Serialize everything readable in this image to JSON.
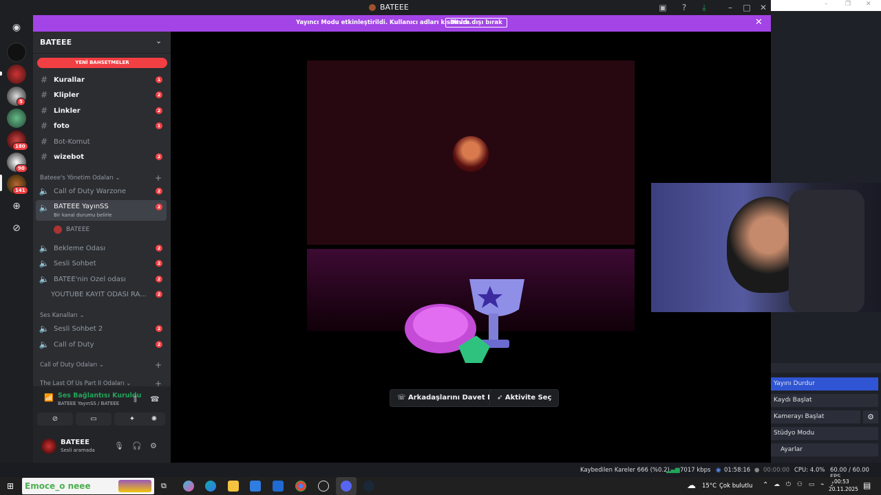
{
  "window": {
    "title": "BATEEE"
  },
  "banner": {
    "message": "Yayıncı Modu etkinleştirildi. Kullanıcı adları kısaltıldı.",
    "button": "Devre dışı bırak"
  },
  "servers": {
    "badges": [
      "5",
      "180",
      "90",
      "141"
    ]
  },
  "guild": {
    "name": "BATEEE",
    "mentions_label": "YENİ BAHSETMELER"
  },
  "channels": [
    {
      "name": "Kurallar",
      "badge": "1"
    },
    {
      "name": "Klipler",
      "badge": "2"
    },
    {
      "name": "Linkler",
      "badge": "2"
    },
    {
      "name": "foto",
      "badge": "1"
    },
    {
      "name": "Bot-Komut",
      "badge": ""
    },
    {
      "name": "wizebot",
      "badge": "2"
    }
  ],
  "categories": {
    "admin": "Bateee's Yönetim Odaları",
    "voice": "Ses Kanalları",
    "cod": "Call of Duty Odaları",
    "tlou": "The Last Of Us Part II Odaları"
  },
  "admin_channels": [
    {
      "name": "Call of Duty Warzone",
      "badge": "2"
    },
    {
      "name": "BATEEE YayınSS",
      "badge": "2",
      "status": "Bir kanal durumu belirle",
      "member": "BATEEE"
    },
    {
      "name": "Bekleme Odası",
      "badge": "2"
    },
    {
      "name": "Sesli Sohbet",
      "badge": "2"
    },
    {
      "name": "BATEE'nin Özel odası",
      "badge": "2"
    },
    {
      "name": "YOUTUBE KAYIT ODASI RA...",
      "badge": "2"
    }
  ],
  "voice_channels": [
    {
      "name": "Sesli Sohbet 2",
      "badge": "2"
    },
    {
      "name": "Call of Duty",
      "badge": "2"
    }
  ],
  "voice_panel": {
    "status": "Ses Bağlantısı Kuruldu",
    "channel": "BATEEE YayınSS / BATEEE"
  },
  "user": {
    "name": "BATEEE",
    "status": "Sesli aramada"
  },
  "stage": {
    "invite": "Arkadaşlarını Davet Et",
    "activity": "Aktivite Seç"
  },
  "obs": {
    "buttons": [
      "Yayını Durdur",
      "Kaydı Başlat",
      "Kamerayı Başlat",
      "Stüdyo Modu",
      "Ayarlar"
    ],
    "status": {
      "dropped": "Kaybedilen Kareler 666 (%0.2)",
      "kbps": "7017 kbps",
      "live_time": "01:58:16",
      "rec_time": "00:00:00",
      "cpu": "CPU: 4.0%",
      "fps": "60.00 / 60.00 FPS"
    }
  },
  "taskbar": {
    "search": "Emoce_o neee",
    "weather_temp": "15°C",
    "weather_desc": "Çok bulutlu",
    "time": "00:53",
    "date": "20.11.2025"
  },
  "colors": {
    "accent": "#a344e6",
    "mention": "#f23f43",
    "connected": "#23a55a",
    "obs_active": "#2f55d4"
  }
}
